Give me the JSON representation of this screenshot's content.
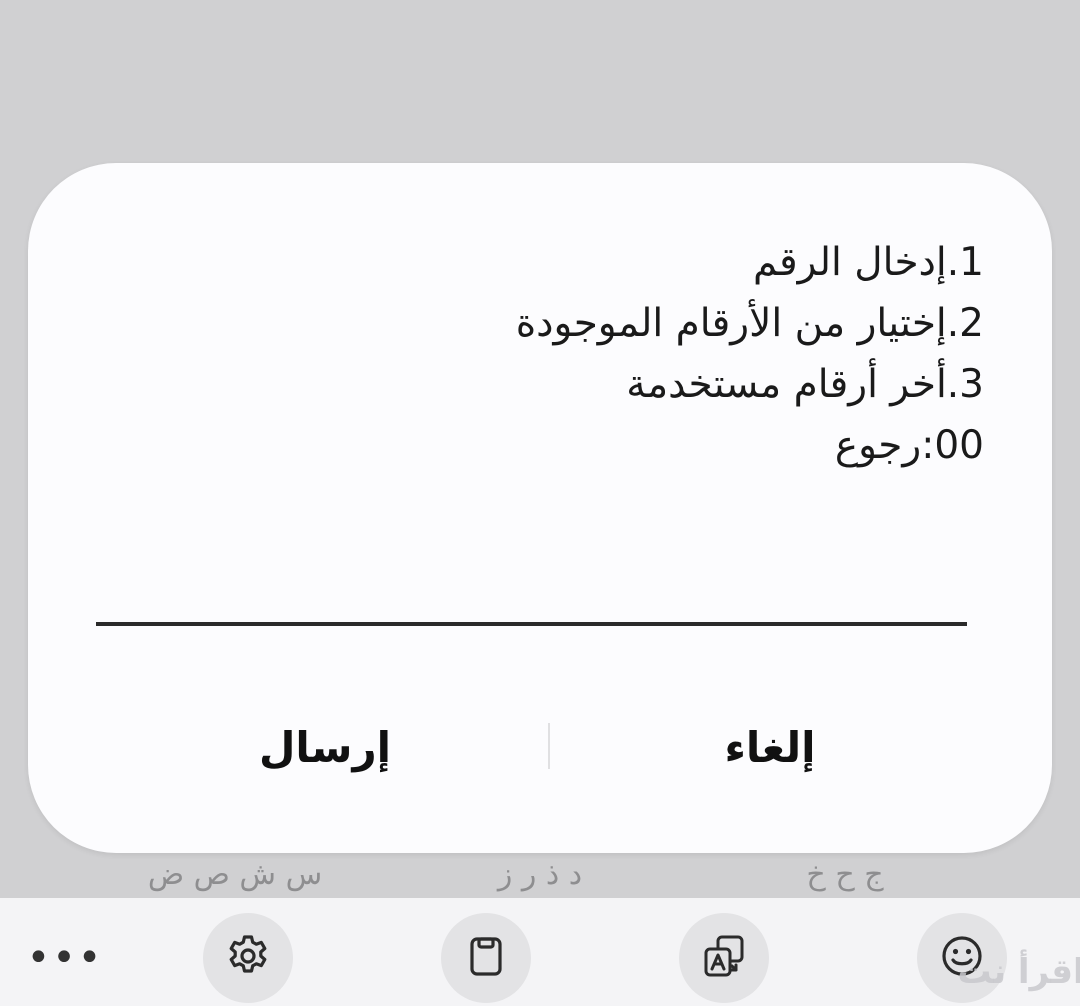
{
  "dialog": {
    "message_lines": [
      "1.إدخال الرقم",
      "2.إختيار من الأرقام الموجودة",
      "3.أخر أرقام مستخدمة",
      "00:رجوع"
    ],
    "input_value": "",
    "send_label": "إرسال",
    "cancel_label": "إلغاء"
  },
  "keyboard": {
    "key_hints": [
      "س ش ص ض",
      "د ذ ر ز",
      "ج ح خ"
    ],
    "more_label": "•••",
    "toolbar_icons": [
      "gear-icon",
      "clipboard-icon",
      "translate-icon",
      "emoji-icon"
    ]
  },
  "watermark": {
    "text": "اقرأ نت"
  },
  "colors": {
    "backdrop": "#d0d0d2",
    "dialog_bg": "#fcfcfe",
    "text": "#1a1a1a",
    "hint_text": "#8e8e90",
    "toolbar_bg": "#f4f4f6",
    "tool_bg": "#e3e3e5"
  }
}
